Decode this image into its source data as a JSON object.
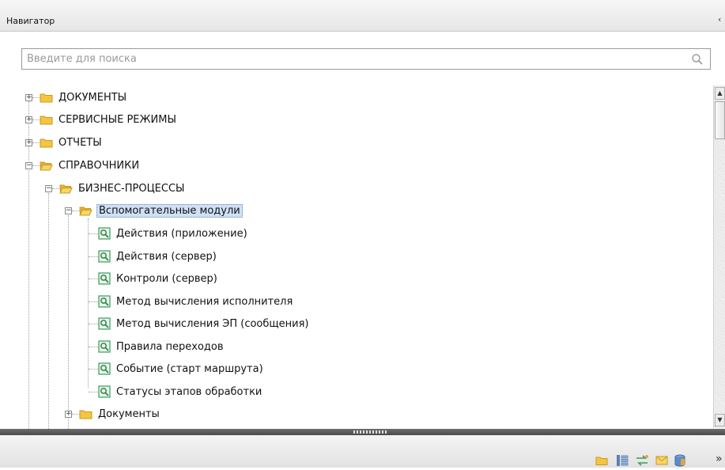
{
  "window": {
    "title": "Навигатор",
    "pin_glyph": "‹"
  },
  "search": {
    "placeholder": "Введите для поиска",
    "value": "",
    "icon": "search-icon"
  },
  "tree": {
    "nodes": [
      {
        "label": "ДОКУМЕНТЫ",
        "level": 0,
        "type": "folder",
        "expanded": false
      },
      {
        "label": "СЕРВИСНЫЕ РЕЖИМЫ",
        "level": 0,
        "type": "folder",
        "expanded": false
      },
      {
        "label": "ОТЧЕТЫ",
        "level": 0,
        "type": "folder",
        "expanded": false
      },
      {
        "label": "СПРАВОЧНИКИ",
        "level": 0,
        "type": "folder",
        "expanded": true
      },
      {
        "label": "БИЗНЕС-ПРОЦЕССЫ",
        "level": 1,
        "type": "folder",
        "expanded": true
      },
      {
        "label": "Вспомогательные модули",
        "level": 2,
        "type": "folder",
        "expanded": true,
        "selected": true
      },
      {
        "label": "Действия (приложение)",
        "level": 3,
        "type": "item"
      },
      {
        "label": "Действия (сервер)",
        "level": 3,
        "type": "item"
      },
      {
        "label": "Контроли (сервер)",
        "level": 3,
        "type": "item"
      },
      {
        "label": "Метод вычисления исполнителя",
        "level": 3,
        "type": "item"
      },
      {
        "label": "Метод вычисления ЭП (сообщения)",
        "level": 3,
        "type": "item"
      },
      {
        "label": "Правила переходов",
        "level": 3,
        "type": "item"
      },
      {
        "label": "Событие (старт маршрута)",
        "level": 3,
        "type": "item"
      },
      {
        "label": "Статусы этапов обработки",
        "level": 3,
        "type": "item"
      },
      {
        "label": "Документы",
        "level": 2,
        "type": "folder",
        "expanded": false
      }
    ]
  },
  "toolbar": {
    "icons": [
      "folder-icon",
      "tree-structure-icon",
      "transfer-icon",
      "mail-icon",
      "database-icon"
    ],
    "more_glyph": "»"
  },
  "colors": {
    "folder_yellow": "#f5c542",
    "selection": "#cfe0f6",
    "item_icon_green": "#3a9d5a"
  }
}
